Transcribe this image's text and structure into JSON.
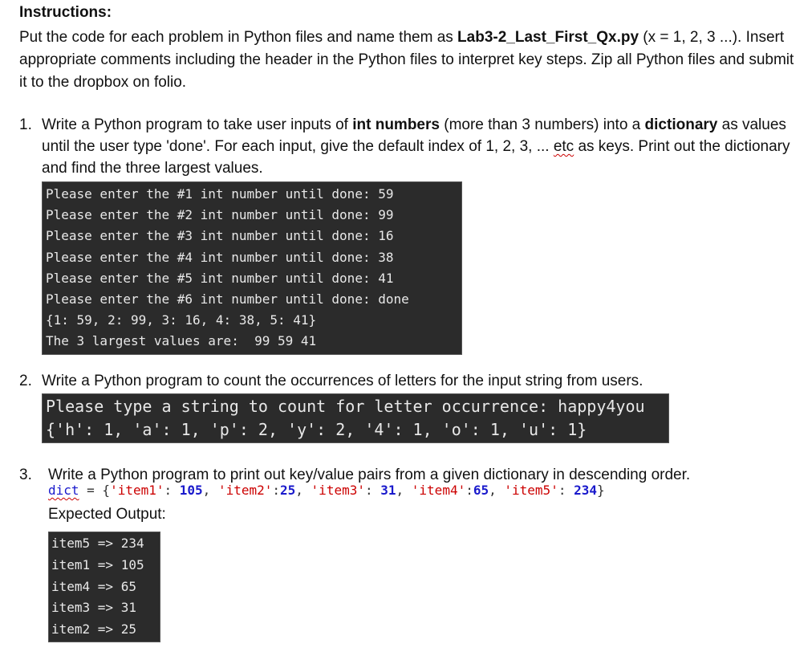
{
  "instructions": {
    "heading": "Instructions:",
    "para": {
      "t1": "Put the code for each problem in Python files and name them as ",
      "filename": "Lab3-2_Last_First_Qx.py",
      "t2": " (x = 1, 2, 3 ...). Insert appropriate comments including the header in the Python files to interpret key steps. Zip all Python files and submit it to the dropbox on folio."
    }
  },
  "q1": {
    "number": "1.",
    "t1": "Write a Python program to take user inputs of ",
    "b1": "int numbers",
    "t2": " (more than 3 numbers) into a ",
    "b2": "dictionary",
    "t3": " as values until the user type 'done'. For each input, give the default index of 1, 2, 3, ... ",
    "etc": "etc",
    "t4": " as keys. Print out the dictionary and find the three largest values.",
    "console": [
      "Please enter the #1 int number until done: 59",
      "Please enter the #2 int number until done: 99",
      "Please enter the #3 int number until done: 16",
      "Please enter the #4 int number until done: 38",
      "Please enter the #5 int number until done: 41",
      "Please enter the #6 int number until done: done",
      "{1: 59, 2: 99, 3: 16, 4: 38, 5: 41}",
      "The 3 largest values are:  99 59 41"
    ]
  },
  "q2": {
    "number": "2.",
    "text": "Write a Python program to count the occurrences of letters for the input string from users.",
    "console": [
      "Please type a string to count for letter occurrence: happy4you",
      "{'h': 1, 'a': 1, 'p': 2, 'y': 2, '4': 1, 'o': 1, 'u': 1}"
    ]
  },
  "q3": {
    "number": "3.",
    "text": "Write a Python program to print out key/value pairs from a given dictionary in descending order.",
    "code": {
      "var": "dict",
      "eq": " = {",
      "k1": "'item1'",
      "s1": ": ",
      "v1": "105",
      "c1": ", ",
      "k2": "'item2'",
      "s2": ":",
      "v2": "25",
      "c2": ", ",
      "k3": "'item3'",
      "s3": ": ",
      "v3": "31",
      "c3": ", ",
      "k4": "'item4'",
      "s4": ":",
      "v4": "65",
      "c4": ", ",
      "k5": "'item5'",
      "s5": ": ",
      "v5": "234",
      "close": "}"
    },
    "expected_label": "Expected Output:",
    "console": [
      "item5 => 234",
      "item1 => 105",
      "item4 => 65",
      "item3 => 31",
      "item2 => 25"
    ]
  }
}
